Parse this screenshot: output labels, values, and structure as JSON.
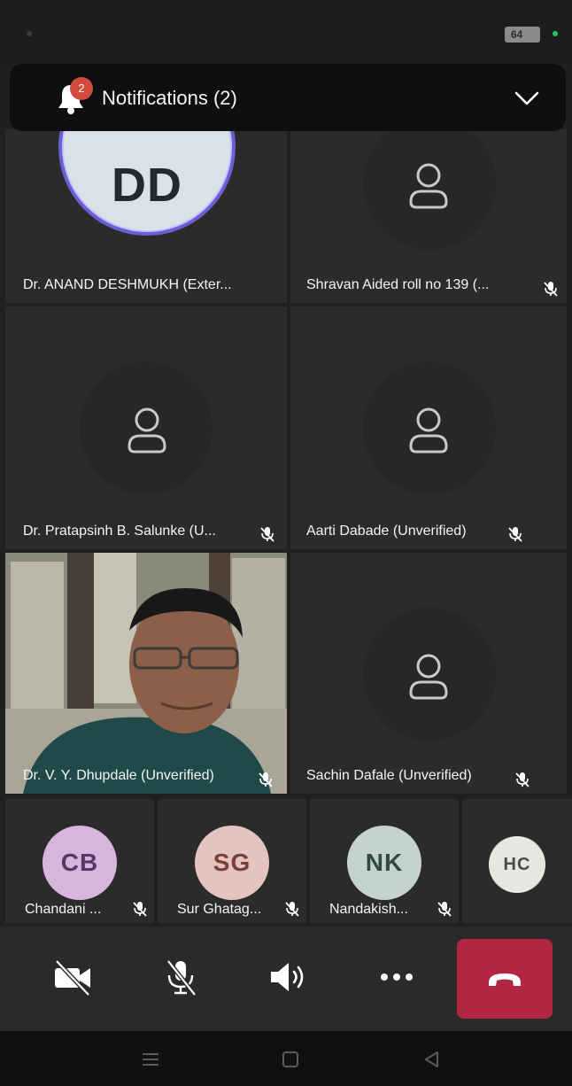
{
  "status_bar": {
    "battery": "64"
  },
  "notifications": {
    "label": "Notifications (2)",
    "badge_count": "2"
  },
  "participants": {
    "p1": {
      "initials": "DD",
      "name": "Dr. ANAND DESHMUKH (Exter..."
    },
    "p2": {
      "name": "Shravan Aided roll no 139 (..."
    },
    "p3": {
      "name": "Dr. Pratapsinh B. Salunke (U..."
    },
    "p4": {
      "name": "Aarti Dabade (Unverified)"
    },
    "p5": {
      "name": "Dr. V. Y. Dhupdale (Unverified)"
    },
    "p6": {
      "name": "Sachin Dafale (Unverified)"
    },
    "p7": {
      "initials": "CB",
      "name": "Chandani ...",
      "color": "#d7b5dc"
    },
    "p8": {
      "initials": "SG",
      "name": "Sur Ghatag...",
      "color": "#e3c4c0"
    },
    "p9": {
      "initials": "NK",
      "name": "Nandakish...",
      "color": "#c5d3cd"
    },
    "p10": {
      "initials": "HC",
      "color": "#e8e6e0"
    }
  },
  "colors": {
    "hangup": "#b3263f",
    "avatar_ring": "#6b5fd6",
    "tile": "#2b2b2b"
  },
  "controls": [
    "camera-off-icon",
    "mic-off-icon",
    "speaker-icon",
    "more-icon",
    "hang-up-icon"
  ],
  "nav": [
    "recents-icon",
    "home-icon",
    "back-icon"
  ]
}
